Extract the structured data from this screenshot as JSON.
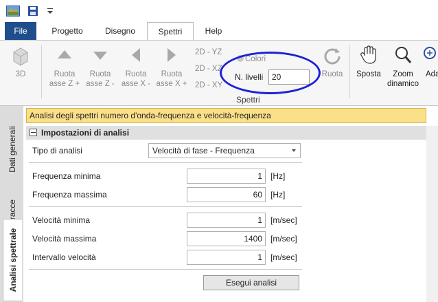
{
  "tabs": [
    "File",
    "Progetto",
    "Disegno",
    "Spettri",
    "Help"
  ],
  "ribbon": {
    "btn_3d": "3D",
    "rotate": [
      {
        "line1": "Ruota",
        "line2": "asse Z +"
      },
      {
        "line1": "Ruota",
        "line2": "asse Z -"
      },
      {
        "line1": "Ruota",
        "line2": "asse X -"
      },
      {
        "line1": "Ruota",
        "line2": "asse X +"
      }
    ],
    "views": [
      "2D - YZ",
      "2D - XZ",
      "2D - XY"
    ],
    "colori": "Colori",
    "n_livelli_label": "N. livelli",
    "n_livelli_value": "20",
    "ruota": "Ruota",
    "group_label": "Spettri",
    "sposta": "Sposta",
    "zoom": {
      "line1": "Zoom",
      "line2": "dinamico"
    },
    "ada": "Ada"
  },
  "side_tabs": [
    "Dati generali",
    "Tracce",
    "Analisi spettrale"
  ],
  "panel": {
    "header": "Analisi degli spettri numero d'onda-frequenza e velocità-frequenza",
    "group_title": "Impostazioni di analisi",
    "tipo_label": "Tipo di analisi",
    "tipo_value": "Velocità di fase - Frequenza",
    "fields": [
      {
        "label": "Frequenza minima",
        "value": "1",
        "unit": "[Hz]"
      },
      {
        "label": "Frequenza massima",
        "value": "60",
        "unit": "[Hz]"
      },
      {
        "label": "Velocità minima",
        "value": "1",
        "unit": "[m/sec]"
      },
      {
        "label": "Velocità massima",
        "value": "1400",
        "unit": "[m/sec]"
      },
      {
        "label": "Intervallo velocità",
        "value": "1",
        "unit": "[m/sec]"
      }
    ],
    "run_button": "Esegui analisi"
  },
  "colors": {
    "accent_file": "#1f4e8c",
    "header_bg": "#fbe08a",
    "highlight_circle": "#1c22d4"
  }
}
